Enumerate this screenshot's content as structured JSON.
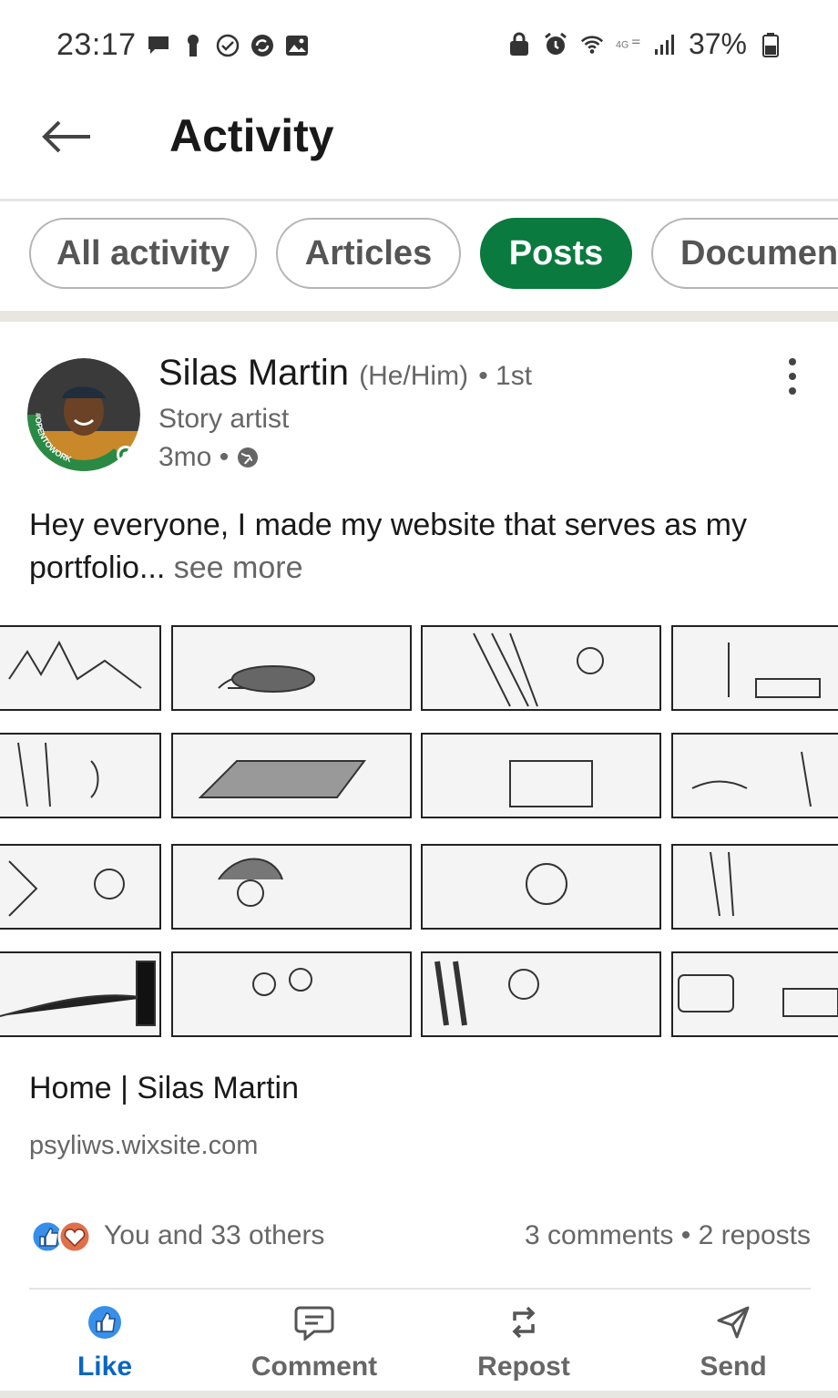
{
  "status_bar": {
    "time": "23:17",
    "battery": "37%",
    "left_icons": [
      "message-icon",
      "keyhole-icon",
      "check-circle-icon",
      "sync-icon",
      "image-icon"
    ],
    "right_icons": [
      "lock-icon",
      "alarm-icon",
      "wifi-icon",
      "lte-icon",
      "signal-icon",
      "battery-icon"
    ]
  },
  "header": {
    "title": "Activity",
    "back_icon": "arrow-left-icon"
  },
  "filters": [
    {
      "label": "All activity",
      "selected": false
    },
    {
      "label": "Articles",
      "selected": false
    },
    {
      "label": "Posts",
      "selected": true
    },
    {
      "label": "Documen",
      "selected": false
    }
  ],
  "post": {
    "author": "Silas Martin",
    "pronouns": "(He/Him)",
    "connection": "• 1st",
    "headline": "Story artist",
    "time": "3mo •",
    "avatar_badge": "#OPENTOWORK",
    "text": "Hey everyone, I made my website that serves as my portfolio...",
    "see_more": "see more",
    "link": {
      "title": "Home | Silas Martin",
      "url": "psyliws.wixsite.com"
    },
    "reactions": "You and 33 others",
    "comments_reposts": "3 comments • 2 reposts"
  },
  "actions": [
    {
      "label": "Like",
      "icon": "thumbs-up-icon",
      "active": true
    },
    {
      "label": "Comment",
      "icon": "comment-icon",
      "active": false
    },
    {
      "label": "Repost",
      "icon": "repost-icon",
      "active": false
    },
    {
      "label": "Send",
      "icon": "send-icon",
      "active": false
    }
  ],
  "colors": {
    "accent_green": "#0a7a3e",
    "like_blue": "#0a66c2"
  }
}
